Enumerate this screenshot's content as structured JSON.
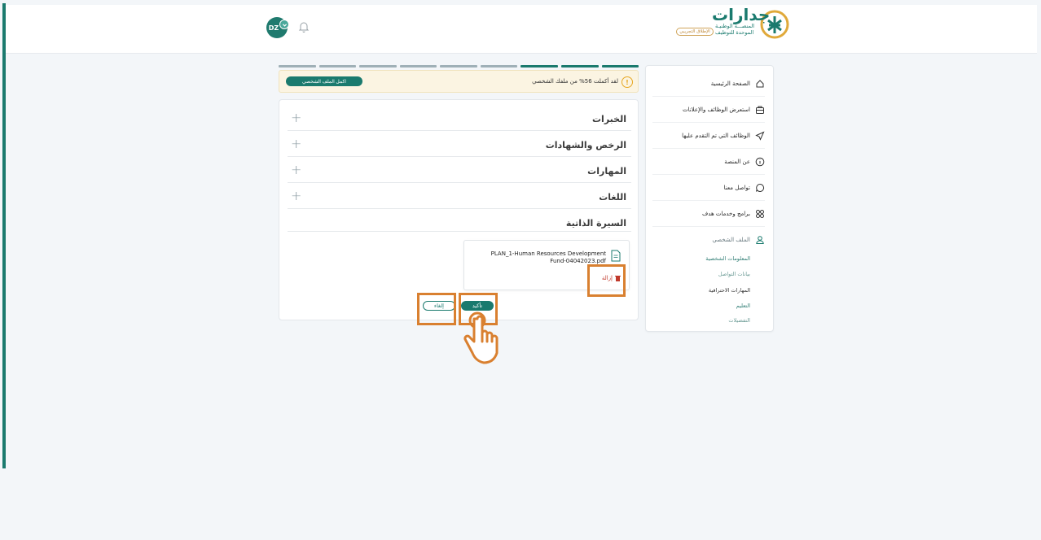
{
  "header": {
    "avatar_initials": "DZ",
    "logo_title": "جدارات",
    "logo_line1": "المنصـــة الوطنيـة",
    "logo_line2": "الموحدة للتوظيف",
    "beta_label": "الإطلاق التجريبي"
  },
  "sidebar": {
    "items": [
      {
        "label": "الصفحة الرئيسية",
        "icon": "home-icon"
      },
      {
        "label": "استعرض الوظائف والإعلانات",
        "icon": "briefcase-icon"
      },
      {
        "label": "الوظائف التي تم التقدم عليها",
        "icon": "send-icon"
      },
      {
        "label": "عن المنصة",
        "icon": "info-icon"
      },
      {
        "label": "تواصل معنا",
        "icon": "chat-icon"
      },
      {
        "label": "برامج وخدمات هدف",
        "icon": "grid-icon"
      },
      {
        "label": "الملف الشخصي",
        "icon": "user-icon"
      }
    ],
    "sub_items": [
      "المعلومات الشخصية",
      "بيانات التواصل",
      "المهارات الاحترافية",
      "التعليم",
      "التفضيلات"
    ]
  },
  "profile": {
    "progress_percent": 56,
    "progress_segments_total": 9,
    "progress_segments_done": 3,
    "alert_text": "لقد أكملت 56% من ملفك الشخصي",
    "complete_button": "اكمل الملف الشخصي"
  },
  "sections": [
    {
      "title": "الخبرات"
    },
    {
      "title": "الرخص والشهادات"
    },
    {
      "title": "المهارات"
    },
    {
      "title": "اللغات"
    },
    {
      "title": "السيرة الذاتية"
    }
  ],
  "cv": {
    "file_name": "PLAN_1-Human Resources Development Fund-04042023.pdf",
    "remove_label": "إزالة",
    "confirm_label": "تأكيد",
    "cancel_label": "إلغاء"
  },
  "colors": {
    "brand": "#1a7a6e",
    "highlight": "#d98030",
    "alert_bg": "#fbf4e2"
  }
}
